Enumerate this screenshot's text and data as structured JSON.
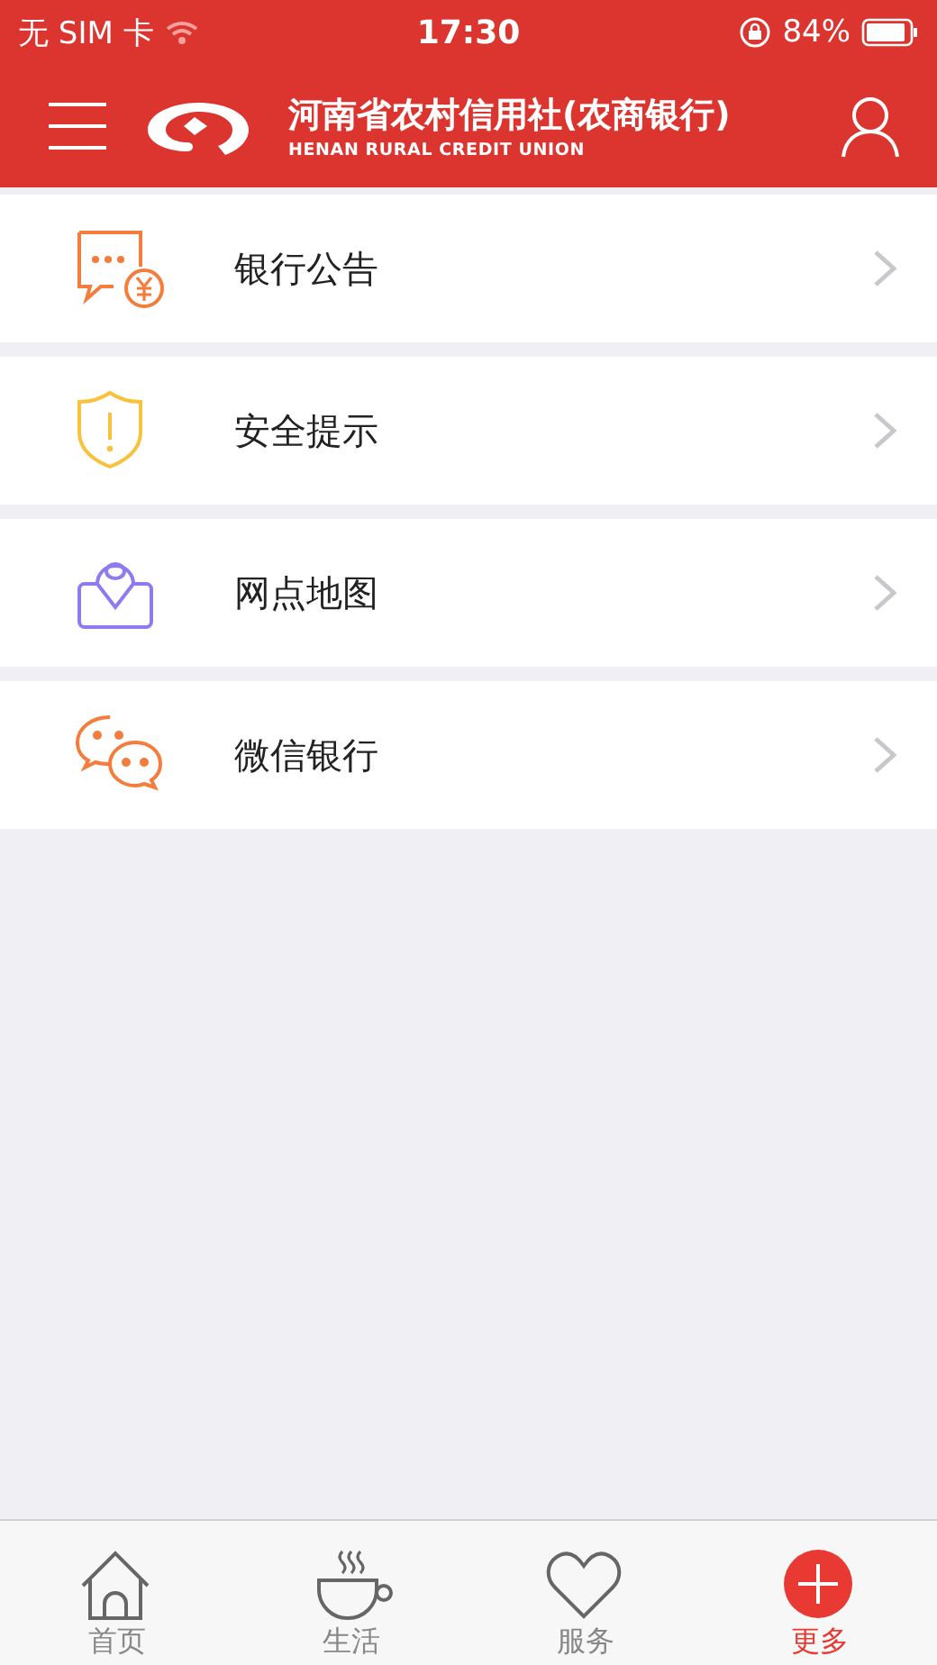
{
  "status_bar": {
    "carrier": "无 SIM 卡",
    "time": "17:30",
    "battery": "84%"
  },
  "header": {
    "title": "河南省农村信用社(农商银行)",
    "subtitle": "HENAN RURAL CREDIT UNION"
  },
  "menu": [
    {
      "kind": "notice",
      "label": "银行公告"
    },
    {
      "kind": "security",
      "label": "安全提示"
    },
    {
      "kind": "map",
      "label": "网点地图"
    },
    {
      "kind": "wechat",
      "label": "微信银行"
    }
  ],
  "tabs": [
    {
      "kind": "home",
      "label": "首页",
      "selected": false
    },
    {
      "kind": "life",
      "label": "生活",
      "selected": false
    },
    {
      "kind": "service",
      "label": "服务",
      "selected": false
    },
    {
      "kind": "more",
      "label": "更多",
      "selected": true
    }
  ]
}
